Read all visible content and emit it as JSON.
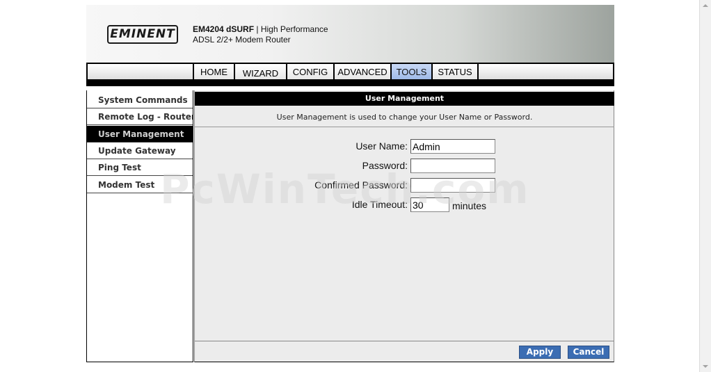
{
  "header": {
    "logo_text": "EMINENT",
    "product_model": "EM4204 dSURF",
    "product_tagline_sep": " | ",
    "product_tagline": "High Performance",
    "product_line2": "ADSL 2/2+ Modem Router"
  },
  "nav": {
    "tabs": [
      {
        "label": "HOME",
        "active": false
      },
      {
        "label": "WIZARD",
        "active": false
      },
      {
        "label": "CONFIG",
        "active": false
      },
      {
        "label": "ADVANCED",
        "active": false
      },
      {
        "label": "TOOLS",
        "active": true
      },
      {
        "label": "STATUS",
        "active": false
      }
    ]
  },
  "sidebar": {
    "items": [
      {
        "label": "System Commands",
        "active": false
      },
      {
        "label": "Remote Log - Router",
        "active": false
      },
      {
        "label": "User Management",
        "active": true
      },
      {
        "label": "Update Gateway",
        "active": false
      },
      {
        "label": "Ping Test",
        "active": false
      },
      {
        "label": "Modem Test",
        "active": false
      }
    ]
  },
  "main": {
    "title": "User Management",
    "description": "User Management is used to change your User Name or Password.",
    "form": {
      "username_label": "User Name:",
      "username_value": "Admin",
      "password_label": "Password:",
      "password_value": "",
      "confirm_label": "Confirmed Password:",
      "confirm_value": "",
      "idle_label": "Idle Timeout:",
      "idle_value": "30",
      "idle_unit": "minutes"
    },
    "buttons": {
      "apply": "Apply",
      "cancel": "Cancel"
    }
  },
  "watermark": "PcWinTech.com",
  "colors": {
    "active_tab": "#9fbbe9",
    "button_blue": "#3b6db3",
    "title_bar": "#000000",
    "content_bg": "#ececec"
  }
}
